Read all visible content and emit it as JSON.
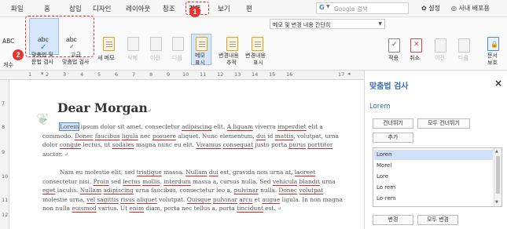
{
  "menu": {
    "items": [
      "파일",
      "홈",
      "삽입",
      "디자인",
      "레이아웃",
      "참조",
      "검토",
      "보기",
      "편"
    ],
    "active": "검토"
  },
  "badges": {
    "one": "1",
    "two": "2"
  },
  "search": {
    "placeholder": "Google 검색",
    "engine_icon": "G"
  },
  "utilities": {
    "settings": "설정",
    "portal": "사내 배포용"
  },
  "ribbon": {
    "abc_left": "ABC",
    "count_label": "개수",
    "spell_check_label_1": "맞춤법 및",
    "spell_check_label_2": "문법 검사",
    "advanced_label_1": "고급",
    "advanced_label_2": "맞춤법 검사",
    "abc": "abc",
    "new_memo": "새 메모",
    "delete": "삭제",
    "prev": "이전",
    "next": "다음",
    "memo_show_1": "메모",
    "memo_show_2": "표시",
    "track_changes_1": "변경내용",
    "track_changes_2": "추적",
    "show_changes_1": "변경내용",
    "show_changes_2": "표시",
    "markup_dropdown": "메모 및 변경 내용 간단히",
    "accept": "적용",
    "reject": "취소",
    "prev2": "이전",
    "next2": "다음",
    "protect_1": "문서",
    "protect_2": "보호"
  },
  "ruler": {
    "numbers": [
      "1",
      "2",
      "3",
      "4",
      "5",
      "6",
      "7",
      "8",
      "9",
      "10",
      "11",
      "12",
      "13",
      "14",
      "15",
      "16",
      "17"
    ],
    "v_numbers": [
      "7",
      "8",
      "9",
      "10",
      "11",
      "12"
    ]
  },
  "document": {
    "title": "Dear Morgan",
    "para1": [
      {
        "t": "Lorem",
        "s": "sel"
      },
      {
        "t": " ipsum dolor sit amet, consectetur "
      },
      {
        "t": "adipiscing",
        "s": "err"
      },
      {
        "t": " elit. "
      },
      {
        "t": "A liguam",
        "s": "err"
      },
      {
        "t": " viverra "
      },
      {
        "t": "imperdiet",
        "s": "err"
      },
      {
        "t": " elit a commodo. "
      },
      {
        "t": "Donec",
        "s": "err"
      },
      {
        "t": " "
      },
      {
        "t": "faucibus",
        "s": "err"
      },
      {
        "t": " "
      },
      {
        "t": "ligula",
        "s": "err"
      },
      {
        "t": " nec "
      },
      {
        "t": "posuere",
        "s": "err"
      },
      {
        "t": " aliquet. Nunc elementum, "
      },
      {
        "t": "dui",
        "s": "err"
      },
      {
        "t": " id "
      },
      {
        "t": "mattis",
        "s": "err"
      },
      {
        "t": ", volutpat, urna dolor "
      },
      {
        "t": "congue",
        "s": "err"
      },
      {
        "t": " lectus, ut "
      },
      {
        "t": "sodales",
        "s": "err"
      },
      {
        "t": " magna nunc eu elit. "
      },
      {
        "t": "Vivamus",
        "s": "err"
      },
      {
        "t": " "
      },
      {
        "t": "consequat",
        "s": "err"
      },
      {
        "t": " justo porta "
      },
      {
        "t": "purus",
        "s": "err"
      },
      {
        "t": " "
      },
      {
        "t": "porttitor",
        "s": "err"
      },
      {
        "t": " auctor."
      }
    ],
    "para2": [
      {
        "t": "Nam eu molestie elit, sed "
      },
      {
        "t": "tristique",
        "s": "err"
      },
      {
        "t": " massa. "
      },
      {
        "t": "Nullam",
        "s": "err"
      },
      {
        "t": " "
      },
      {
        "t": "dui",
        "s": "err"
      },
      {
        "t": " est, gravida non urna at, "
      },
      {
        "t": "laoreet",
        "s": "err"
      },
      {
        "t": " consectetur nisi. "
      },
      {
        "t": "Proin",
        "s": "err"
      },
      {
        "t": " sed "
      },
      {
        "t": "lectus",
        "s": "err"
      },
      {
        "t": " "
      },
      {
        "t": "mollis",
        "s": "err"
      },
      {
        "t": ", "
      },
      {
        "t": "interdum",
        "s": "err"
      },
      {
        "t": " massa a, cursus nulla. Sed "
      },
      {
        "t": "vehicula",
        "s": "err"
      },
      {
        "t": " "
      },
      {
        "t": "blandit",
        "s": "err"
      },
      {
        "t": " urna "
      },
      {
        "t": "eget",
        "s": "err"
      },
      {
        "t": " iaculis. "
      },
      {
        "t": "Nullam",
        "s": "err"
      },
      {
        "t": " "
      },
      {
        "t": "adipiscing",
        "s": "err"
      },
      {
        "t": " urna faucibus, consectetur leo a, "
      },
      {
        "t": "pulvinar",
        "s": "err"
      },
      {
        "t": " nulla. "
      },
      {
        "t": "Donec",
        "s": "err"
      },
      {
        "t": " "
      },
      {
        "t": "volutpat",
        "s": "err"
      },
      {
        "t": " molestie urna, "
      },
      {
        "t": "vel",
        "s": "err"
      },
      {
        "t": " "
      },
      {
        "t": "sagittis",
        "s": "err"
      },
      {
        "t": " "
      },
      {
        "t": "risus",
        "s": "err"
      },
      {
        "t": " "
      },
      {
        "t": "aliquet",
        "s": "err"
      },
      {
        "t": " volutpat. "
      },
      {
        "t": "Quisque",
        "s": "err"
      },
      {
        "t": " "
      },
      {
        "t": "pulvinar",
        "s": "err"
      },
      {
        "t": " "
      },
      {
        "t": "arcu",
        "s": "err"
      },
      {
        "t": " et "
      },
      {
        "t": "augue",
        "s": "err"
      },
      {
        "t": " ligula. In non magna non nulla "
      },
      {
        "t": "euismod",
        "s": "err"
      },
      {
        "t": " varius. Ut "
      },
      {
        "t": "enim",
        "s": "err"
      },
      {
        "t": " diam, porta nec tellus a, porta "
      },
      {
        "t": "tincidunt",
        "s": "err"
      },
      {
        "t": " est."
      }
    ]
  },
  "panel": {
    "title": "맞춤법 검사",
    "close": "×",
    "word": "Lorem",
    "ignore": "건너뛰기",
    "ignore_all": "모두 건너뛰기",
    "add": "추가",
    "suggestions": [
      "Loren",
      "Morel",
      "Lore",
      "Lo rem",
      "Lo-rem"
    ],
    "change": "변경",
    "change_all": "모두 변경"
  },
  "colors": {
    "accent": "#3b6fb6",
    "highlight_red": "#e8342c",
    "selection": "#cfe1f7"
  }
}
